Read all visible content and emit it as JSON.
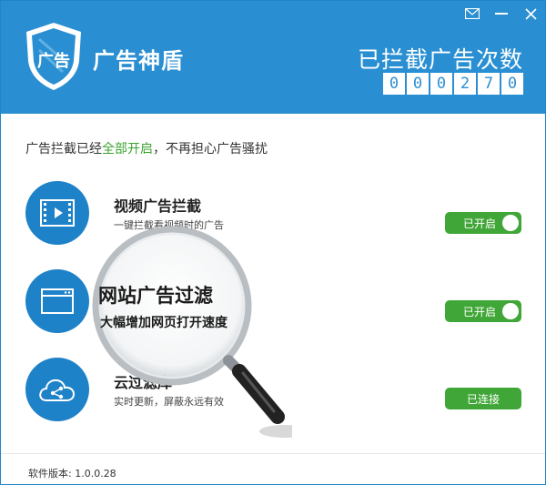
{
  "app": {
    "title": "广告神盾",
    "logo_text": "广告"
  },
  "window_controls": {
    "mail_icon": "mail-icon",
    "minimize_icon": "minimize-icon",
    "close_icon": "close-icon"
  },
  "counter": {
    "label": "已拦截广告次数",
    "digits": [
      "0",
      "0",
      "0",
      "2",
      "7",
      "0"
    ]
  },
  "status": {
    "prefix": "广告拦截已经",
    "highlight": "全部开启",
    "suffix": "，不再担心广告骚扰"
  },
  "features": [
    {
      "icon": "video-icon",
      "title": "视频广告拦截",
      "desc": "一键拦截看视频时的广告",
      "button": "已开启"
    },
    {
      "icon": "browser-window-icon",
      "title": "网站广告过滤",
      "desc": "大幅增加网页打开速度",
      "button": "已开启"
    },
    {
      "icon": "cloud-share-icon",
      "title": "云过滤库",
      "desc": "实时更新，屏蔽永远有效",
      "button": "已连接"
    }
  ],
  "footer": {
    "version": "软件版本: 1.0.0.28"
  },
  "colors": {
    "header_bg": "#2a8fd2",
    "accent_green": "#41a638",
    "icon_circle": "#1e82c8"
  }
}
